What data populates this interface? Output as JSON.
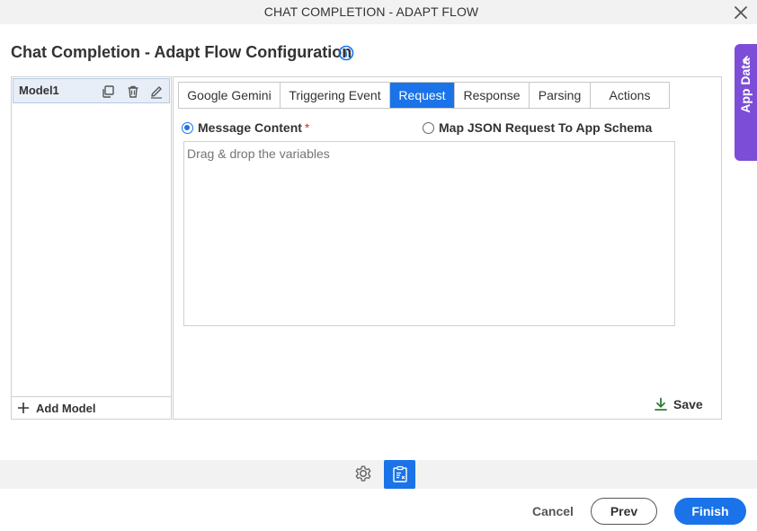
{
  "window": {
    "title": "CHAT COMPLETION - ADAPT FLOW"
  },
  "page": {
    "title": "Chat Completion - Adapt Flow Configuration"
  },
  "app_data": {
    "label": "App Data",
    "accent": "#7c4dd6"
  },
  "models": {
    "items": [
      {
        "label": "Model1"
      }
    ],
    "add_label": "Add Model"
  },
  "tabs": {
    "items": [
      {
        "label": "Google Gemini",
        "active": false
      },
      {
        "label": "Triggering Event",
        "active": false
      },
      {
        "label": "Request",
        "active": true
      },
      {
        "label": "Response",
        "active": false
      },
      {
        "label": "Parsing",
        "active": false
      },
      {
        "label": "Actions",
        "active": false
      }
    ]
  },
  "request": {
    "option_message": {
      "label": "Message Content",
      "required_mark": "*",
      "selected": true
    },
    "option_map": {
      "label": "Map JSON Request To App Schema",
      "selected": false
    },
    "content_placeholder": "Drag & drop the variables",
    "content_value": "",
    "save_label": "Save"
  },
  "footer": {
    "cancel_label": "Cancel",
    "prev_label": "Prev",
    "finish_label": "Finish"
  },
  "colors": {
    "primary": "#1a73e8",
    "purple": "#7c4dd6",
    "save_icon": "#2e7d32",
    "required": "#d32f2f"
  }
}
